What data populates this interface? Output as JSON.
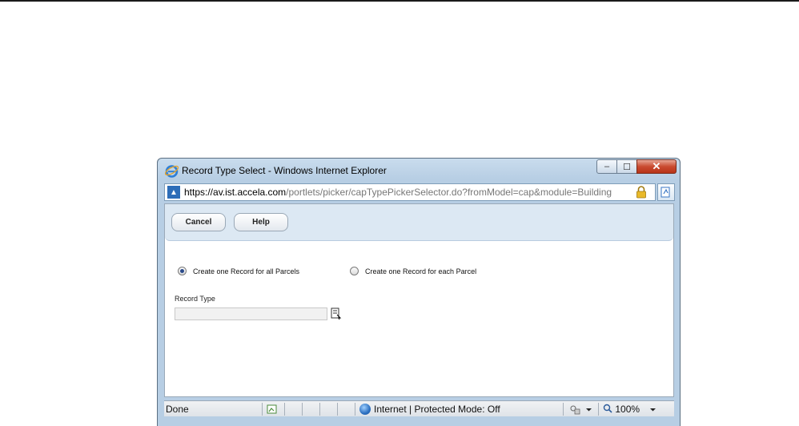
{
  "window": {
    "title": "Record Type Select - Windows Internet Explorer",
    "address": {
      "scheme": "https://av.ist.",
      "domain": "accela.com",
      "path": "/portlets/picker/capTypePickerSelector.do?fromModel=cap&module=Building"
    },
    "minimize_label": "–",
    "maximize_label": "☐",
    "close_label": "✕"
  },
  "toolbar": {
    "cancel_label": "Cancel",
    "help_label": "Help"
  },
  "options": {
    "all_parcels_label": "Create one Record for all Parcels",
    "each_parcel_label": "Create one Record for each Parcel",
    "selected": "all_parcels"
  },
  "form": {
    "record_type_label": "Record Type",
    "record_type_value": ""
  },
  "status": {
    "done": "Done",
    "zone": "Internet | Protected Mode: Off",
    "zoom": "100%"
  },
  "colors": {
    "title_bar": "#b7cee4",
    "toolbar_bg": "#dce8f3",
    "close_button": "#c94a30"
  }
}
